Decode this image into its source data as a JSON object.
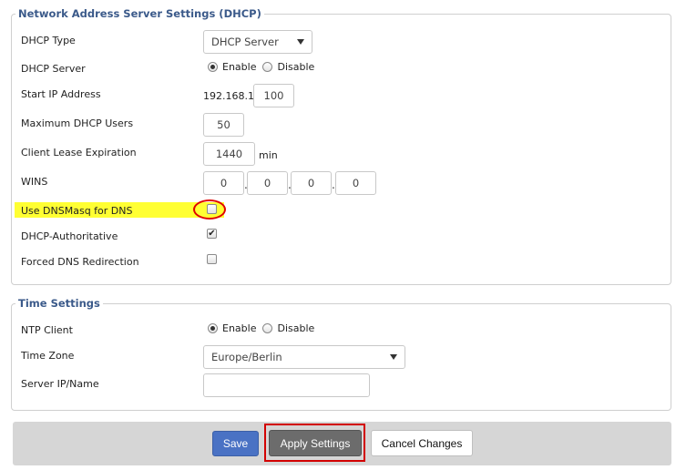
{
  "dhcp_section": {
    "title": "Network Address Server Settings (DHCP)",
    "dhcp_type": {
      "label": "DHCP Type",
      "value": "DHCP Server"
    },
    "dhcp_server": {
      "label": "DHCP Server",
      "options": [
        "Enable",
        "Disable"
      ],
      "selected": "Enable"
    },
    "start_ip": {
      "label": "Start IP Address",
      "prefix": "192.168.1.",
      "value": "100"
    },
    "max_users": {
      "label": "Maximum DHCP Users",
      "value": "50"
    },
    "lease": {
      "label": "Client Lease Expiration",
      "value": "1440",
      "unit": "min"
    },
    "wins": {
      "label": "WINS",
      "octets": [
        "0",
        "0",
        "0",
        "0"
      ],
      "separator": "."
    },
    "dnsmasq": {
      "label": "Use DNSMasq for DNS",
      "checked": false
    },
    "authoritative": {
      "label": "DHCP-Authoritative",
      "checked": true
    },
    "forced_dns": {
      "label": "Forced DNS Redirection",
      "checked": false
    }
  },
  "time_section": {
    "title": "Time Settings",
    "ntp_client": {
      "label": "NTP Client",
      "options": [
        "Enable",
        "Disable"
      ],
      "selected": "Enable"
    },
    "time_zone": {
      "label": "Time Zone",
      "value": "Europe/Berlin"
    },
    "server": {
      "label": "Server IP/Name",
      "value": ""
    }
  },
  "actions": {
    "save_label": "Save",
    "apply_label": "Apply Settings",
    "cancel_label": "Cancel Changes"
  },
  "colors": {
    "highlight": "#ffff33",
    "annotation_red": "#d20000",
    "save_blue": "#4a72c4",
    "apply_gray": "#6c6c6c"
  }
}
